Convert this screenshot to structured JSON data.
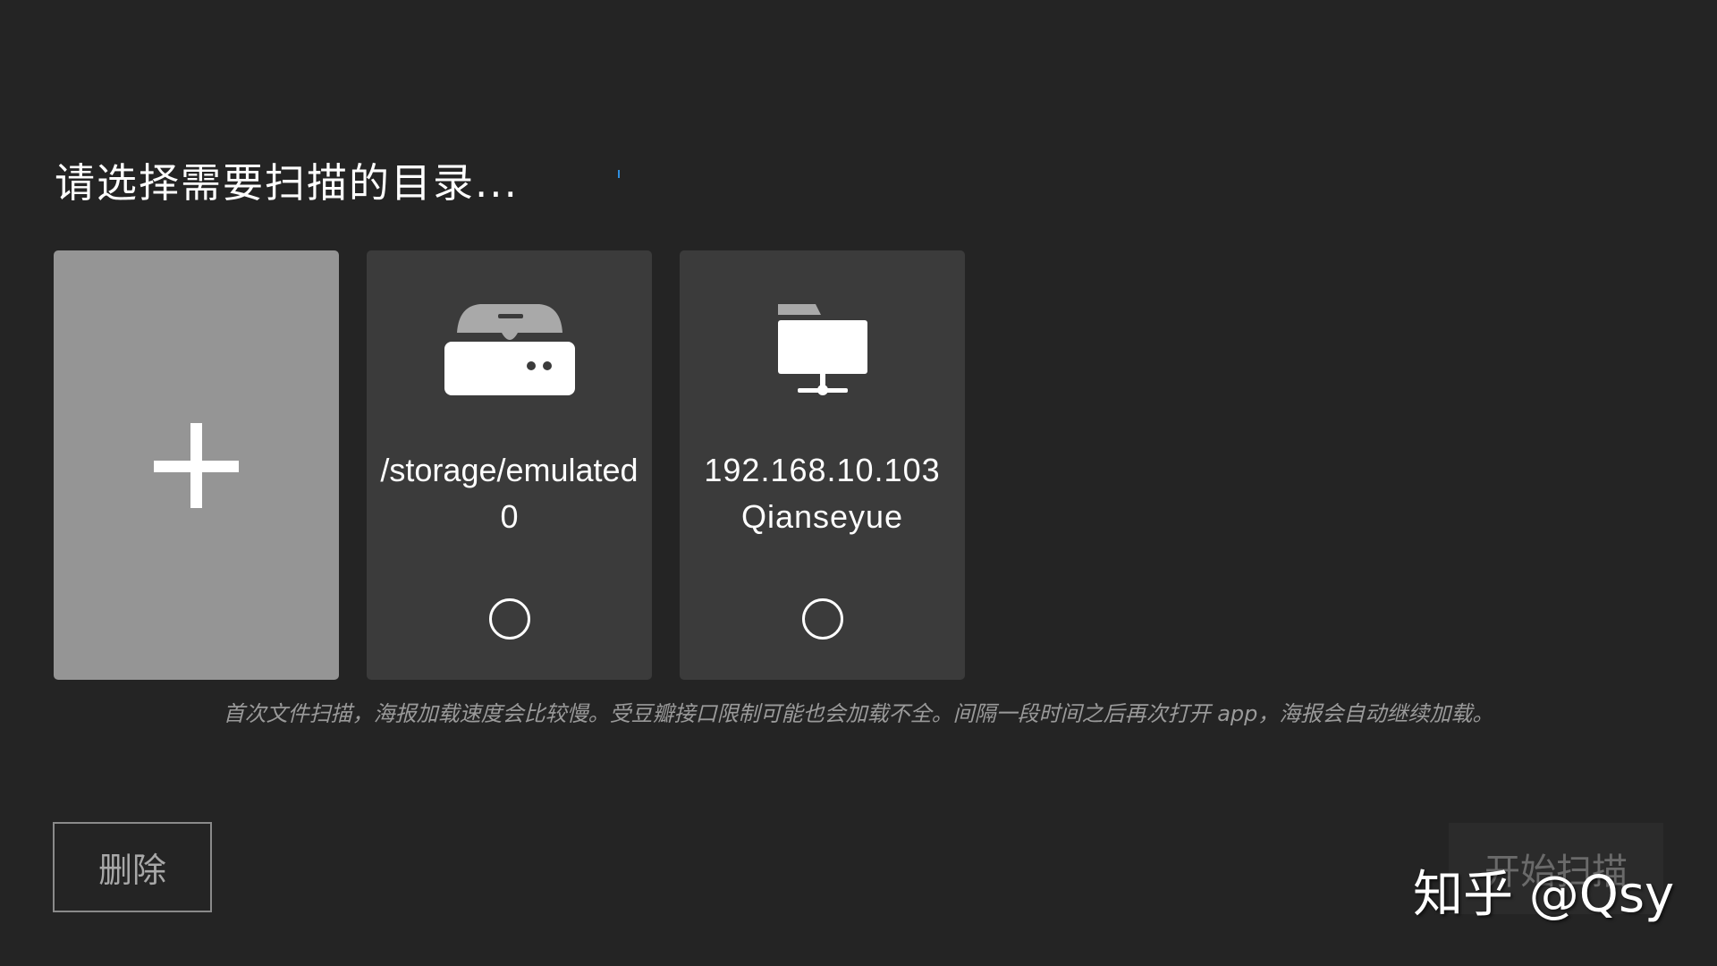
{
  "header": {
    "title": "请选择需要扫描的目录..."
  },
  "cards": {
    "add": {
      "icon": "plus-icon"
    },
    "local": {
      "icon": "hard-drive-icon",
      "line1": "/storage/emulated",
      "line2": "0",
      "selected": false
    },
    "network": {
      "icon": "network-folder-icon",
      "line1": "192.168.10.103",
      "line2": "Qianseyue",
      "selected": false
    }
  },
  "notice": "首次文件扫描，海报加载速度会比较慢。受豆瓣接口限制可能也会加载不全。间隔一段时间之后再次打开 app，海报会自动继续加载。",
  "buttons": {
    "delete_label": "删除",
    "start_label": "开始扫描"
  },
  "watermark": "知乎 @Qsy",
  "colors": {
    "background": "#242424",
    "card": "#3b3b3b",
    "add_card": "#959595",
    "notice_text": "#9a9a9a",
    "accent": "#2f8fe0"
  }
}
